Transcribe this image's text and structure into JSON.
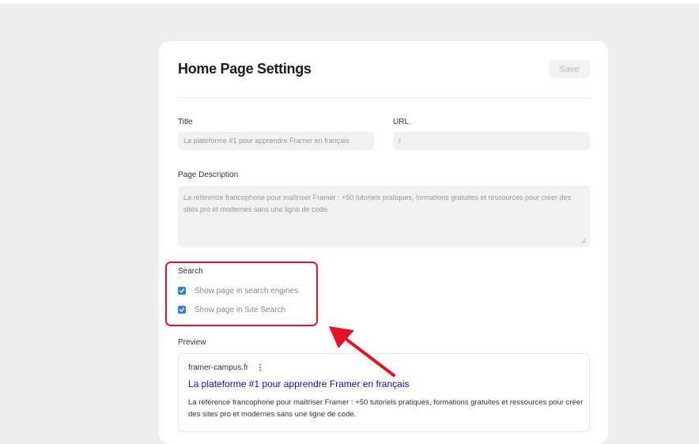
{
  "panel": {
    "heading": "Home Page Settings",
    "save_label": "Save"
  },
  "fields": {
    "title_label": "Title",
    "title_value": "La plateforme #1 pour apprendre Framer en français",
    "url_label": "URL",
    "url_value": "/",
    "description_label": "Page Description",
    "description_value": "La référence francophone pour maîtriser Framer : +50 tutoriels pratiques, formations gratuites et ressources pour créer des sites pro et modernes sans une ligne de code."
  },
  "search": {
    "label": "Search",
    "options": [
      {
        "label": "Show page in search engines",
        "checked": true
      },
      {
        "label": "Show page in Site Search",
        "checked": true
      }
    ]
  },
  "preview": {
    "label": "Preview",
    "domain": "framer-campus.fr",
    "menu_glyph": "⋮",
    "title": "La plateforme #1 pour apprendre Framer en français",
    "description": "La référence francophone pour maîtriser Framer : +50 tutoriels pratiques, formations gratuites et ressources pour créer des sites pro et modernes sans une ligne de code."
  },
  "colors": {
    "highlight": "#e41326",
    "checkbox": "#2f80dc",
    "link": "#1a0dab"
  },
  "icons": [
    "check-icon",
    "resize-grip-icon",
    "more-vertical-icon",
    "annotation-arrow-icon"
  ]
}
